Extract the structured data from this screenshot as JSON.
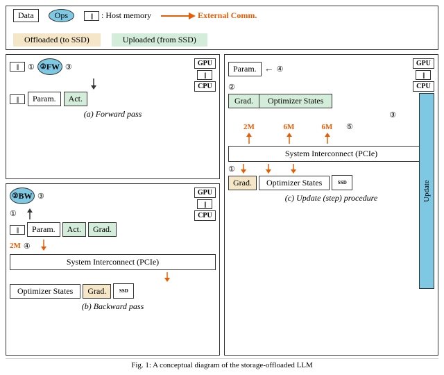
{
  "legend": {
    "data_label": "Data",
    "ops_label": "Ops",
    "host_mem_label": ": Host memory",
    "ext_comm_label": "External Comm.",
    "offloaded_label": "Offloaded (to SSD)",
    "uploaded_label": "Uploaded (from SSD)"
  },
  "forward": {
    "title": "(a) Forward pass",
    "num1": "①",
    "num2": "②",
    "num3": "③",
    "fw_label": "FW",
    "param_label": "Param.",
    "act_label": "Act.",
    "gpu_label": "GPU",
    "cpu_label": "CPU"
  },
  "backward": {
    "title": "(b) Backward pass",
    "num1": "①",
    "num2": "②",
    "num3": "③",
    "num4": "④",
    "bw_label": "BW",
    "param_label": "Param.",
    "act_label": "Act.",
    "grad_label": "Grad.",
    "gpu_label": "GPU",
    "cpu_label": "CPU",
    "transfer_2m": "2M",
    "sys_interconnect": "System Interconnect (PCIe)",
    "optimizer_label": "Optimizer States",
    "grad_offload": "Grad."
  },
  "update": {
    "title": "(c) Update (step) procedure",
    "num1": "①",
    "num2": "②",
    "num3": "③",
    "num4": "④",
    "num5": "⑤",
    "param_label": "Param.",
    "grad_label": "Grad.",
    "optimizer_label": "Optimizer States",
    "update_label": "Update",
    "gpu_label": "GPU",
    "cpu_label": "CPU",
    "transfer_2m": "2M",
    "transfer_6m_1": "6M",
    "transfer_6m_2": "6M",
    "sys_interconnect": "System Interconnect (PCIe)",
    "grad_bottom": "Grad.",
    "opt_bottom": "Optimizer States"
  },
  "fig_caption": "Fig. 1: A conceptual diagram of the storage-offloaded LLM"
}
